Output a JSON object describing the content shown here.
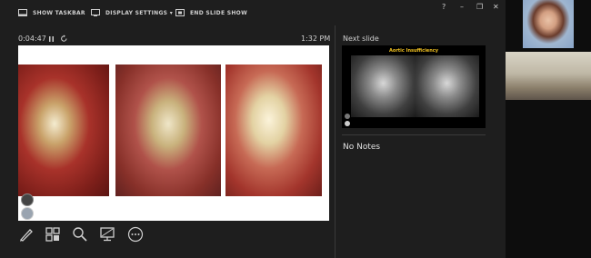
{
  "toolbar": {
    "show_taskbar": "SHOW TASKBAR",
    "display_settings": "DISPLAY SETTINGS ▾",
    "end_slide_show": "END SLIDE SHOW"
  },
  "presenter": {
    "timer": "0:04:47",
    "clock": "1:32 PM",
    "next_slide_label": "Next slide",
    "next_slide_title": "Aortic Insufficiency",
    "notes": "No Notes"
  },
  "icons": {
    "pause": "pause-icon",
    "restart": "restart-icon",
    "pen": "pen-icon",
    "slides_grid": "slides-grid-icon",
    "zoom": "zoom-icon",
    "screen": "black-screen-icon",
    "more": "more-options-icon"
  },
  "colors": {
    "background": "#1e1e1e",
    "accent_title": "#f0c020"
  }
}
